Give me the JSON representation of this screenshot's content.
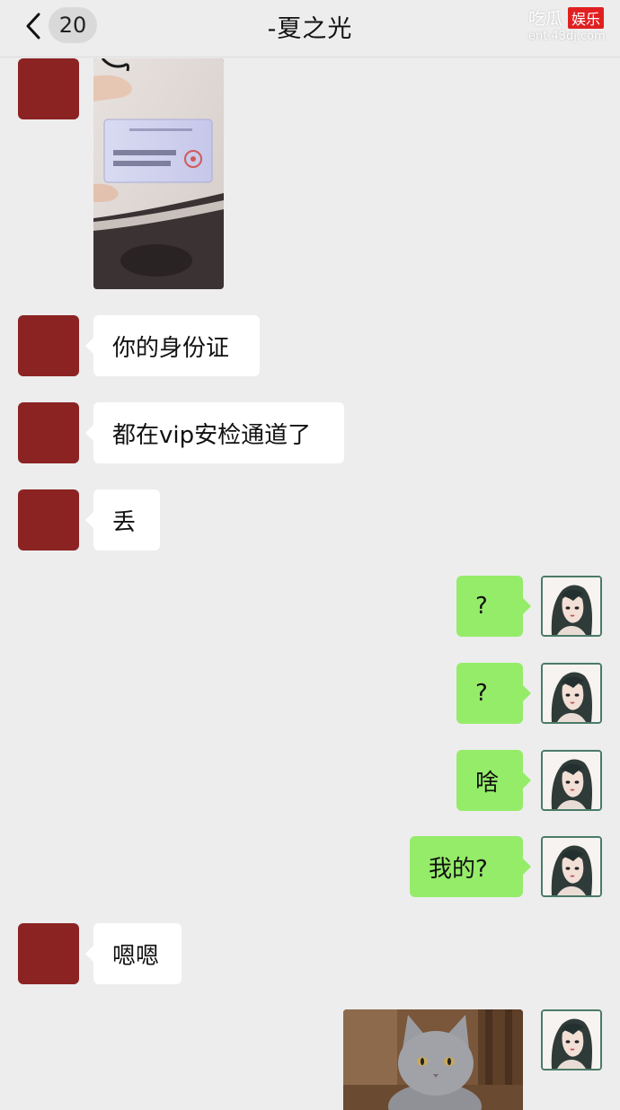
{
  "header": {
    "unread_count": "20",
    "title": "-夏之光",
    "watermark": {
      "site_cn": "吃瓜",
      "site_tag": "娱乐",
      "site_url": "ent.43dj.com"
    }
  },
  "messages": [
    {
      "side": "received",
      "type": "image",
      "content": "photo of ID card"
    },
    {
      "side": "received",
      "type": "text",
      "text": "你的身份证"
    },
    {
      "side": "received",
      "type": "text",
      "text": "都在vip安检通道了"
    },
    {
      "side": "received",
      "type": "text",
      "text": "丢"
    },
    {
      "side": "sent",
      "type": "text",
      "text": "?"
    },
    {
      "side": "sent",
      "type": "text",
      "text": "?"
    },
    {
      "side": "sent",
      "type": "text",
      "text": "啥"
    },
    {
      "side": "sent",
      "type": "text",
      "text": "我的?"
    },
    {
      "side": "received",
      "type": "text",
      "text": "嗯嗯"
    },
    {
      "side": "sent",
      "type": "image",
      "content": "grey cat photo"
    }
  ],
  "colors": {
    "background": "#ededed",
    "received_bubble": "#ffffff",
    "sent_bubble": "#95ec69",
    "contact_avatar": "#8c2323"
  }
}
